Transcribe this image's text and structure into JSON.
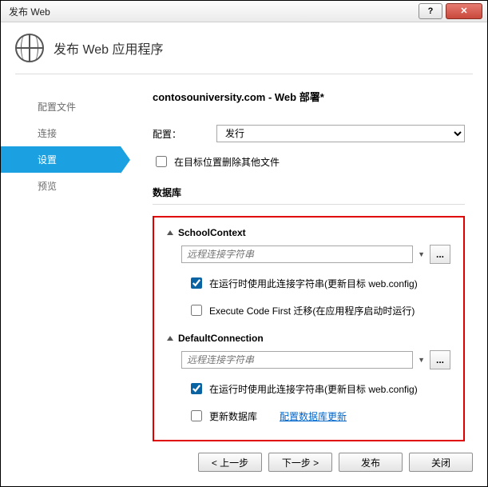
{
  "window": {
    "title": "发布 Web"
  },
  "header": {
    "title": "发布 Web 应用程序"
  },
  "nav": {
    "items": [
      {
        "label": "配置文件"
      },
      {
        "label": "连接"
      },
      {
        "label": "设置"
      },
      {
        "label": "预览"
      }
    ],
    "active_index": 2
  },
  "content": {
    "site_title": "contosouniversity.com - Web 部署*",
    "config_label": "配置：",
    "config_options": [
      "发行"
    ],
    "config_selected": "发行",
    "delete_extra_label": "在目标位置删除其他文件",
    "delete_extra_checked": false,
    "db_section_title": "数据库"
  },
  "db": {
    "contexts": [
      {
        "name": "SchoolContext",
        "conn_placeholder": "远程连接字符串",
        "use_conn_label": "在运行时使用此连接字符串(更新目标 web.config)",
        "use_conn_checked": true,
        "second_option_label": "Execute Code First 迁移(在应用程序启动时运行)",
        "second_option_checked": false
      },
      {
        "name": "DefaultConnection",
        "conn_placeholder": "远程连接字符串",
        "use_conn_label": "在运行时使用此连接字符串(更新目标 web.config)",
        "use_conn_checked": true,
        "second_option_label": "更新数据库",
        "second_option_checked": false,
        "link_label": "配置数据库更新"
      }
    ]
  },
  "footer": {
    "prev": "< 上一步",
    "next": "下一步 >",
    "publish": "发布",
    "close": "关闭"
  },
  "glyphs": {
    "help": "?",
    "close": "✕",
    "ellipsis": "..."
  }
}
